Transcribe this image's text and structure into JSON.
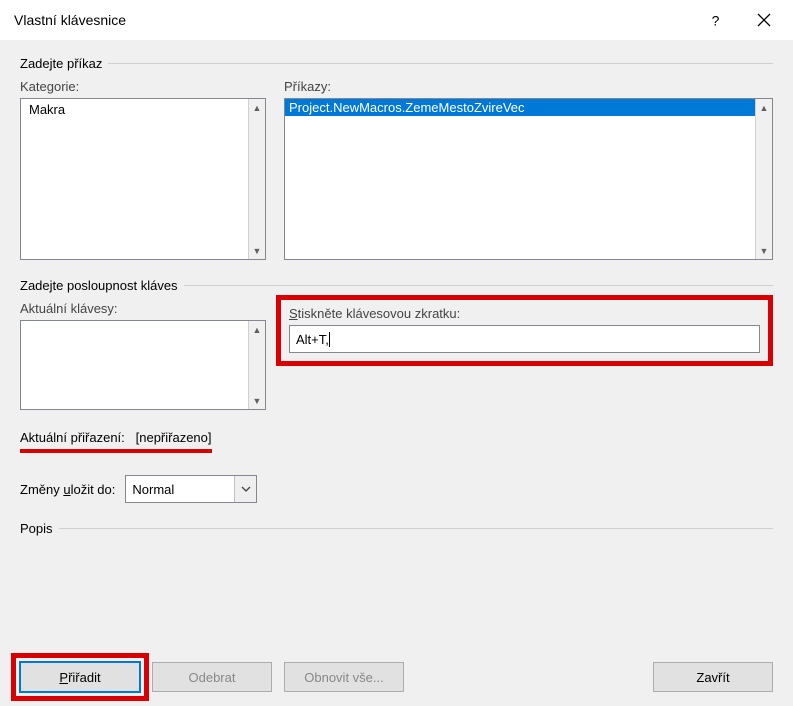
{
  "titlebar": {
    "title": "Vlastní klávesnice"
  },
  "groups": {
    "specify_command": "Zadejte příkaz",
    "specify_sequence": "Zadejte posloupnost kláves",
    "description": "Popis"
  },
  "labels": {
    "categories": "Kategorie:",
    "commands": "Příkazy:",
    "current_keys": "Aktuální klávesy:",
    "press_shortcut_pre": "S",
    "press_shortcut_post": "tiskněte klávesovou zkratku:",
    "current_assignment_label": "Aktuální přiřazení:",
    "current_assignment_value": "[nepřiřazeno]",
    "save_changes_pre": "Změny ",
    "save_changes_u": "u",
    "save_changes_post": "ložit do:"
  },
  "lists": {
    "categories": {
      "items": [
        "Makra"
      ]
    },
    "commands": {
      "items": [
        "Project.NewMacros.ZemeMestoZvireVec"
      ],
      "selected_index": 0
    }
  },
  "inputs": {
    "shortcut_value": "Alt+T,"
  },
  "combo": {
    "save_in": "Normal"
  },
  "buttons": {
    "assign_pre": "P",
    "assign_u": "ř",
    "assign_post": "iřadit",
    "remove": "Odebrat",
    "reset": "Obnovit vše...",
    "close": "Zavřít"
  }
}
